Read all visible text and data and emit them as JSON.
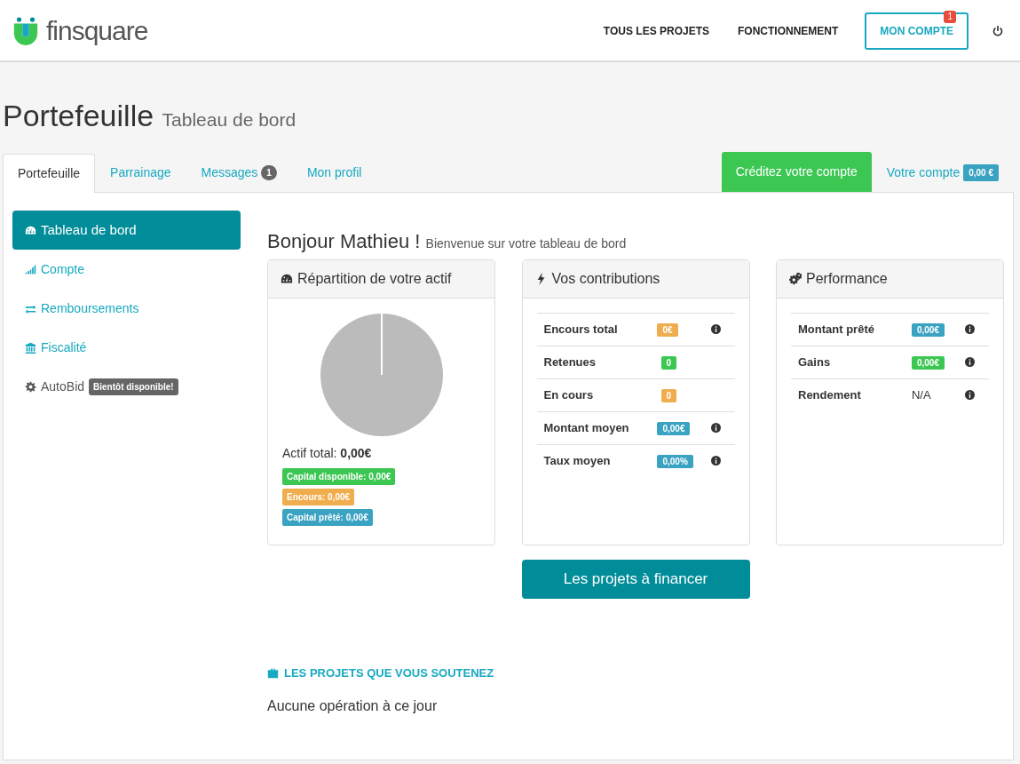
{
  "header": {
    "logo_text": "finsquare",
    "nav": [
      {
        "label": "TOUS LES PROJETS",
        "kind": "link"
      },
      {
        "label": "FONCTIONNEMENT",
        "kind": "link"
      },
      {
        "label": "MON COMPTE",
        "kind": "outline",
        "badge": "1"
      }
    ]
  },
  "page_title": {
    "title": "Portefeuille",
    "subtitle": "Tableau de bord"
  },
  "tabs": [
    {
      "label": "Portefeuille",
      "selected": true
    },
    {
      "label": "Parrainage",
      "selected": false
    },
    {
      "label": "Messages",
      "selected": false,
      "badge": "1"
    },
    {
      "label": "Mon profil",
      "selected": false
    }
  ],
  "credit_button": "Créditez votre compte",
  "account_link": {
    "label": "Votre compte",
    "badge": "0,00 €"
  },
  "sidebar": [
    {
      "label": "Tableau de bord",
      "selected": true
    },
    {
      "label": "Compte",
      "selected": false
    },
    {
      "label": "Remboursements",
      "selected": false
    },
    {
      "label": "Fiscalité",
      "selected": false
    },
    {
      "label": "AutoBid",
      "selected": false,
      "disabled": true,
      "badge": "Bientôt disponible!"
    }
  ],
  "greeting": {
    "title": "Bonjour Mathieu !",
    "subtitle": "Bienvenue sur votre tableau de bord"
  },
  "cards": [
    {
      "title": "Répartition de votre actif",
      "kind": "pie",
      "total_label": "Actif total:",
      "total_value": "0,00€",
      "legend": [
        {
          "text": "Capital disponible: 0,00€",
          "color": "#3cc753"
        },
        {
          "text": "Encours: 0,00€",
          "color": "#f0ad4e"
        },
        {
          "text": "Capital prêté: 0,00€",
          "color": "#3aa3c2"
        }
      ]
    },
    {
      "title": "Vos contributions",
      "kind": "stats",
      "rows": [
        {
          "label": "Encours total",
          "value": "0€",
          "color": "#f0ad4e",
          "info": true
        },
        {
          "label": "Retenues",
          "value": "0",
          "color": "#3cc753",
          "info": false
        },
        {
          "label": "En cours",
          "value": "0",
          "color": "#f0ad4e",
          "info": false
        },
        {
          "label": "Montant moyen",
          "value": "0,00€",
          "color": "#3aa3c2",
          "info": true
        },
        {
          "label": "Taux moyen",
          "value": "0,00%",
          "color": "#3aa3c2",
          "info": true
        }
      ]
    },
    {
      "title": "Performance",
      "kind": "stats",
      "rows": [
        {
          "label": "Montant prêté",
          "value": "0,00€",
          "color": "#3aa3c2",
          "info": true
        },
        {
          "label": "Gains",
          "value": "0,00€",
          "color": "#3cc753",
          "info": true
        },
        {
          "label": "Rendement",
          "value": "N/A",
          "info": true
        }
      ]
    }
  ],
  "projects_button": "Les projets à financer",
  "supported": {
    "heading": "LES PROJETS QUE VOUS SOUTENEZ",
    "empty": "Aucune opération à ce jour"
  }
}
